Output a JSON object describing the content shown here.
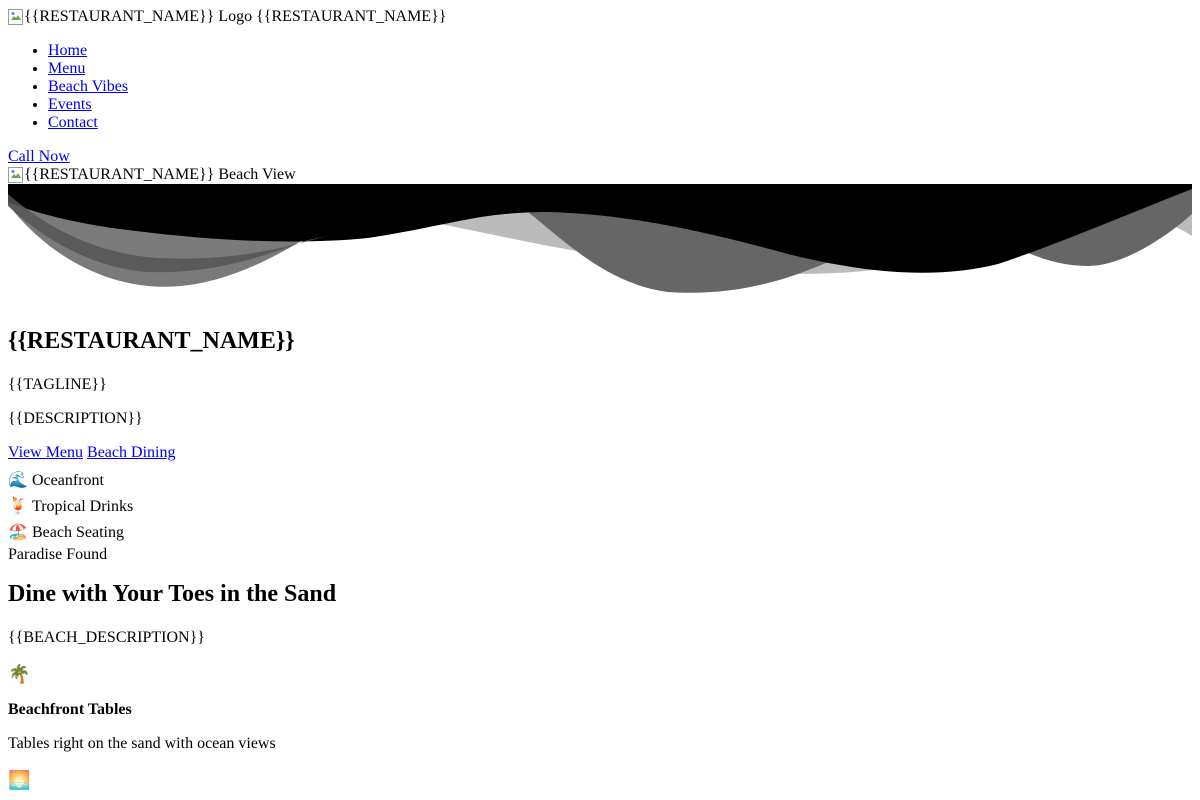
{
  "header": {
    "logo_alt": "{{RESTAURANT_NAME}} Logo",
    "restaurant_name": "{{RESTAURANT_NAME}}"
  },
  "nav": {
    "items": [
      {
        "label": "Home"
      },
      {
        "label": "Menu"
      },
      {
        "label": "Beach Vibes"
      },
      {
        "label": "Events"
      },
      {
        "label": "Contact"
      }
    ]
  },
  "call_now": "Call Now",
  "hero": {
    "image_alt": "{{RESTAURANT_NAME}} Beach View",
    "title": "{{RESTAURANT_NAME}}",
    "tagline": "{{TAGLINE}}",
    "description": "{{DESCRIPTION}}",
    "cta_primary": "View Menu",
    "cta_secondary": "Beach Dining",
    "features": [
      {
        "emoji": "🌊",
        "label": "Oceanfront"
      },
      {
        "emoji": "🍹",
        "label": "Tropical Drinks"
      },
      {
        "emoji": "🏖️",
        "label": "Beach Seating"
      }
    ]
  },
  "beach_section": {
    "eyebrow": "Paradise Found",
    "title": "Dine with Your Toes in the Sand",
    "description": "{{BEACH_DESCRIPTION}}",
    "cards": [
      {
        "emoji": "🌴",
        "title": "Beachfront Tables",
        "text": "Tables right on the sand with ocean views"
      },
      {
        "emoji": "🌅"
      }
    ]
  },
  "colors": {
    "link": "#0000ee",
    "wave_dark": "#000000",
    "wave_mid": "#666666",
    "wave_light": "#bbbbbb"
  }
}
